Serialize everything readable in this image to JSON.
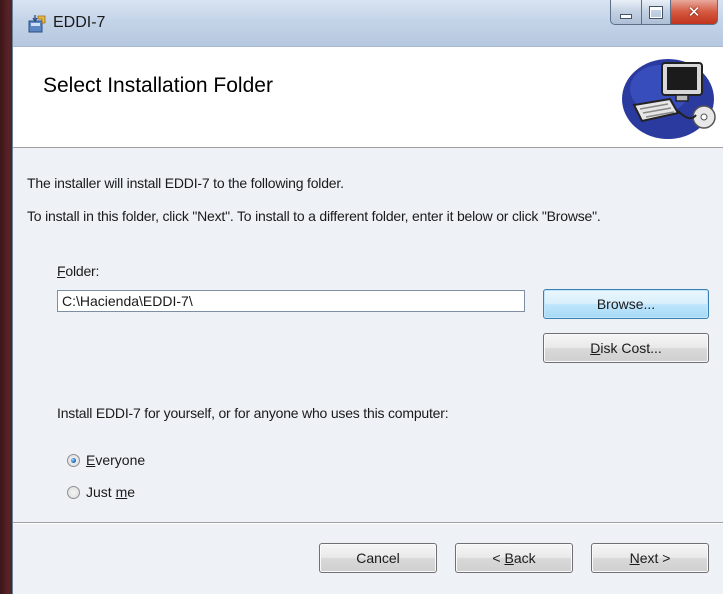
{
  "window": {
    "title": "EDDI-7",
    "controls": {
      "minimize": "minimize",
      "maximize": "maximize",
      "close": "close"
    }
  },
  "header": {
    "title": "Select Installation Folder",
    "graphic_icon": "computer-install-icon"
  },
  "body": {
    "line1": "The installer will install EDDI-7 to the following folder.",
    "line2": "To install in this folder, click \"Next\". To install to a different folder, enter it below or click \"Browse\".",
    "folder_label_mnemonic": "F",
    "folder_label_rest": "older:",
    "folder_value": "C:\\Hacienda\\EDDI-7\\",
    "install_for_text": "Install EDDI-7 for yourself, or for anyone who uses this computer:"
  },
  "buttons": {
    "browse": "Browse...",
    "disk_cost_mnemonic": "D",
    "disk_cost_rest": "isk Cost...",
    "cancel": "Cancel",
    "back_prefix": "< ",
    "back_mnemonic": "B",
    "back_rest": "ack",
    "next_mnemonic": "N",
    "next_rest": "ext >"
  },
  "install_scope": {
    "selected": "Everyone",
    "options": [
      {
        "mnemonic": "E",
        "rest": "veryone",
        "checked": true
      },
      {
        "prefix": "Just ",
        "mnemonic": "m",
        "rest": "e",
        "checked": false
      }
    ]
  },
  "colors": {
    "accent_button": "#bee6fd",
    "close_button": "#c2331c",
    "titlebar": "#c4d4e8"
  }
}
